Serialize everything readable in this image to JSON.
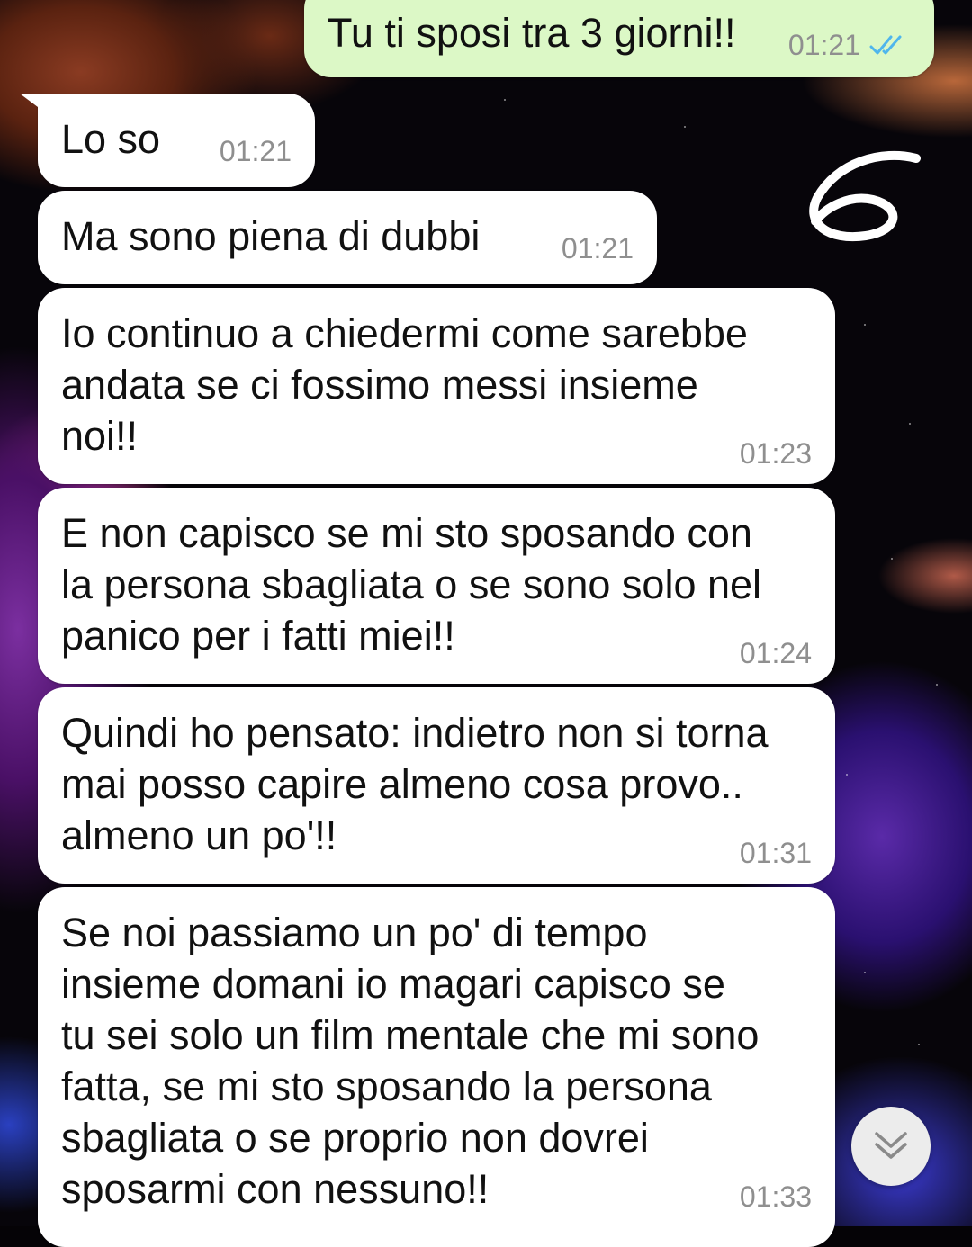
{
  "colors": {
    "incoming_bubble": "#ffffff",
    "outgoing_bubble": "#dcf8c6",
    "read_ticks": "#4fb6ec",
    "time_text": "#8f8f8f"
  },
  "messages": [
    {
      "direction": "outgoing",
      "text": "Tu ti sposi tra 3 giorni!!",
      "time": "01:21",
      "status_icon": "double-check-read-icon"
    },
    {
      "direction": "incoming",
      "text": "Lo so",
      "time": "01:21"
    },
    {
      "direction": "incoming",
      "text": "Ma sono piena di dubbi",
      "time": "01:21"
    },
    {
      "direction": "incoming",
      "text": "Io continuo a chiedermi come sarebbe\nandata se ci fossimo messi insieme\nnoi!!",
      "time": "01:23"
    },
    {
      "direction": "incoming",
      "text": "E non capisco se mi sto sposando con\nla persona sbagliata o se sono solo nel\npanico per i fatti miei!!",
      "time": "01:24"
    },
    {
      "direction": "incoming",
      "text": "Quindi ho pensato: indietro non si torna\nmai posso capire almeno cosa provo..\nalmeno un po'!!",
      "time": "01:31"
    },
    {
      "direction": "incoming",
      "text": "Se noi passiamo un po' di tempo\ninsieme domani io magari capisco se\ntu sei solo un film mentale che mi sono\nfatta, se mi sto sposando la persona\nsbagliata o se proprio non dovrei\nsposarmi con nessuno!!",
      "time": "01:33"
    }
  ],
  "annotation": {
    "text": "6"
  },
  "scroll_down_button": {
    "icon": "double-chevron-down-icon"
  }
}
